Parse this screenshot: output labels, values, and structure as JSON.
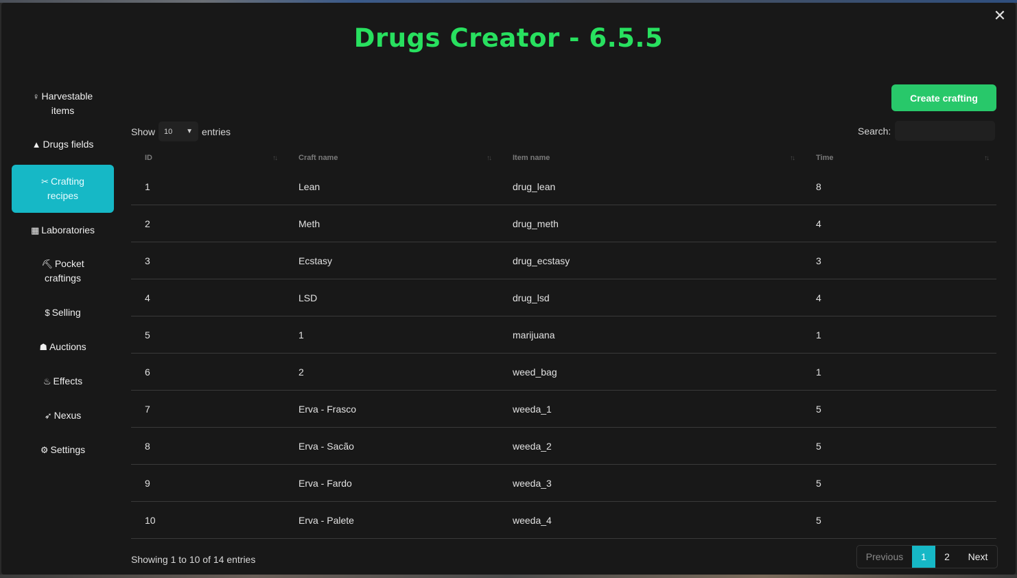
{
  "window": {
    "title": "Drugs Creator - 6.5.5"
  },
  "sidebar": {
    "items": [
      {
        "icon": "♀",
        "line1": "Harvestable",
        "line2": "items"
      },
      {
        "icon": "▲",
        "line1": "Drugs fields",
        "line2": ""
      },
      {
        "icon": "✂",
        "line1": "Crafting",
        "line2": "recipes"
      },
      {
        "icon": "▦",
        "line1": "Laboratories",
        "line2": ""
      },
      {
        "icon": "⛏",
        "line1": "Pocket",
        "line2": "craftings"
      },
      {
        "icon": "$",
        "line1": "Selling",
        "line2": ""
      },
      {
        "icon": "☗",
        "line1": "Auctions",
        "line2": ""
      },
      {
        "icon": "♨",
        "line1": "Effects",
        "line2": ""
      },
      {
        "icon": "➶",
        "line1": "Nexus",
        "line2": ""
      },
      {
        "icon": "⚙",
        "line1": "Settings",
        "line2": ""
      }
    ]
  },
  "toolbar": {
    "create_label": "Create crafting"
  },
  "length_control": {
    "show_label": "Show",
    "value": "10",
    "entries_label": "entries"
  },
  "search": {
    "label": "Search:",
    "value": ""
  },
  "table": {
    "columns": [
      "ID",
      "Craft name",
      "Item name",
      "Time"
    ],
    "rows": [
      [
        "1",
        "Lean",
        "drug_lean",
        "8"
      ],
      [
        "2",
        "Meth",
        "drug_meth",
        "4"
      ],
      [
        "3",
        "Ecstasy",
        "drug_ecstasy",
        "3"
      ],
      [
        "4",
        "LSD",
        "drug_lsd",
        "4"
      ],
      [
        "5",
        "1",
        "marijuana",
        "1"
      ],
      [
        "6",
        "2",
        "weed_bag",
        "1"
      ],
      [
        "7",
        "Erva - Frasco",
        "weeda_1",
        "5"
      ],
      [
        "8",
        "Erva - Sacão",
        "weeda_2",
        "5"
      ],
      [
        "9",
        "Erva - Fardo",
        "weeda_3",
        "5"
      ],
      [
        "10",
        "Erva - Palete",
        "weeda_4",
        "5"
      ]
    ]
  },
  "footer": {
    "info": "Showing 1 to 10 of 14 entries",
    "pagination": {
      "previous": "Previous",
      "pages": [
        "1",
        "2"
      ],
      "next": "Next"
    }
  },
  "colors": {
    "title": "#28e05f",
    "accent": "#16b8c6",
    "create_button": "#28c86a",
    "background": "#181818"
  }
}
